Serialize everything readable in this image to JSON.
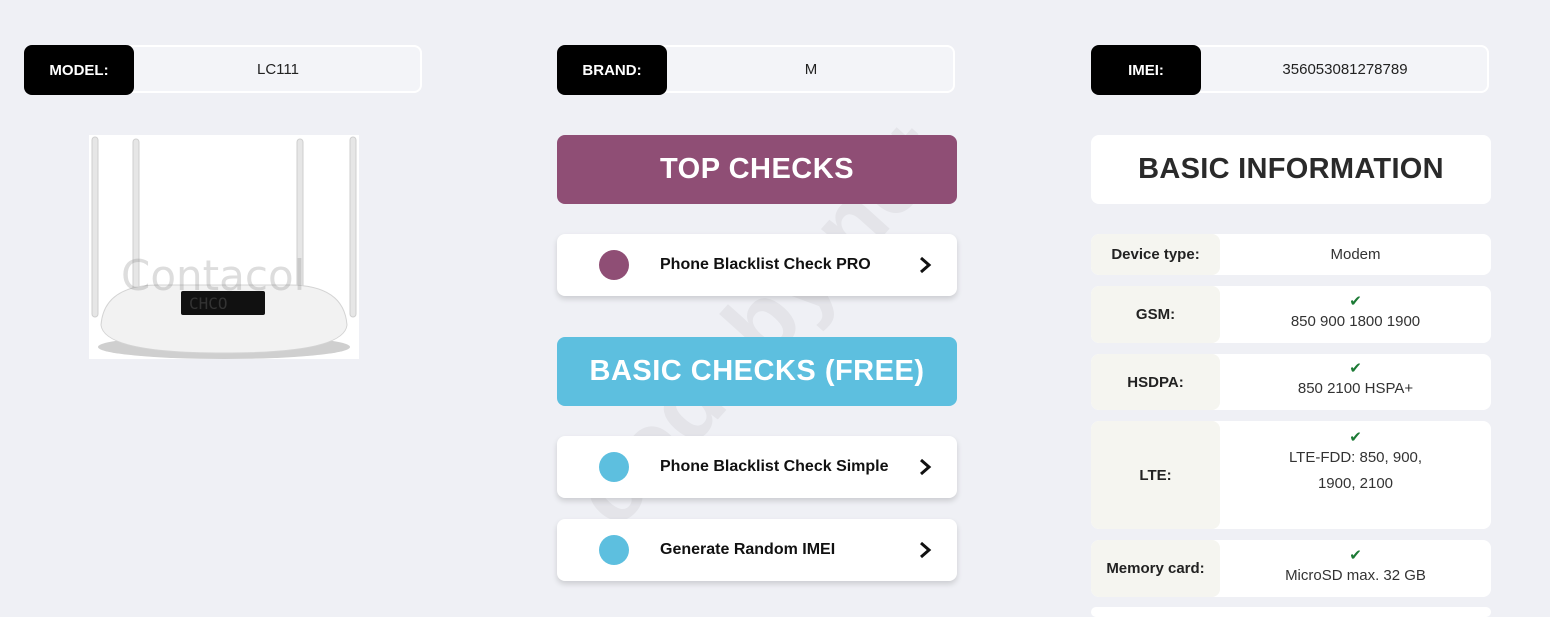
{
  "top_fields": {
    "model": {
      "label": "MODEL:",
      "value": "LC111"
    },
    "brand": {
      "label": "BRAND:",
      "value": "M"
    },
    "imei": {
      "label": "IMEI:",
      "value": "356053081278789"
    }
  },
  "sections": {
    "top_checks_title": "TOP CHECKS",
    "basic_checks_title": "BASIC CHECKS (FREE)"
  },
  "top_checks": [
    {
      "label": "Phone Blacklist Check PRO",
      "color": "#8f4e75"
    }
  ],
  "basic_checks": [
    {
      "label": "Phone Blacklist Check Simple",
      "color": "#5dbfdf"
    },
    {
      "label": "Generate Random IMEI",
      "color": "#5dbfdf"
    }
  ],
  "basic_info": {
    "title": "BASIC INFORMATION",
    "rows": [
      {
        "key": "Device type:",
        "value": "Modem",
        "check": false
      },
      {
        "key": "GSM:",
        "value": "850 900 1800 1900",
        "check": true
      },
      {
        "key": "HSDPA:",
        "value": "850 2100 HSPA+",
        "check": true
      },
      {
        "key": "LTE:",
        "value": "LTE-FDD: 850, 900,",
        "value2": "1900, 2100",
        "check": true
      },
      {
        "key": "Memory card:",
        "value": "MicroSD max. 32 GB",
        "check": true
      }
    ]
  },
  "image": {
    "logo_text": "Contacol"
  },
  "watermark": "codeby.net",
  "icons": {
    "chevron": "chevron-right-icon",
    "check": "check-mark-icon"
  }
}
